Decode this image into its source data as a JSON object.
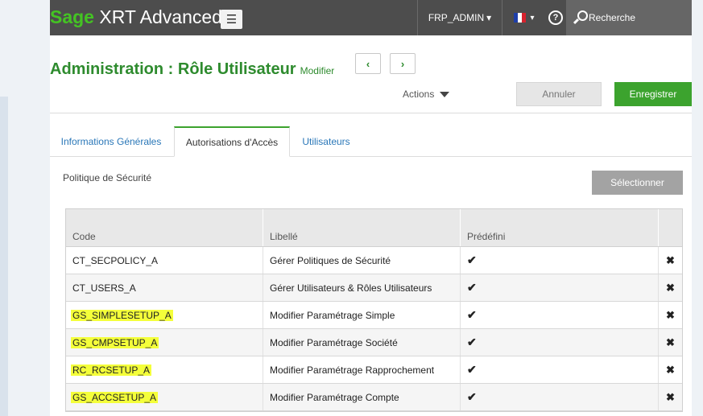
{
  "topbar": {
    "brand": "Sage",
    "product": "XRT Advanced",
    "menu_icon": "hamburger-icon",
    "user": "FRP_ADMIN",
    "language_flag_colors": [
      "#1f3fa8",
      "#ffffff",
      "#d6222d"
    ],
    "search_placeholder": "Recherche"
  },
  "header": {
    "title": "Administration : Rôle Utilisateur",
    "mode": "Modifier",
    "prev_symbol": "‹",
    "next_symbol": "›",
    "actions_label": "Actions",
    "cancel_label": "Annuler",
    "save_label": "Enregistrer"
  },
  "tabs": [
    {
      "label": "Informations Générales",
      "active": false
    },
    {
      "label": "Autorisations d'Accès",
      "active": true
    },
    {
      "label": "Utilisateurs",
      "active": false
    }
  ],
  "section": {
    "label": "Politique de Sécurité",
    "select_label": "Sélectionner"
  },
  "table": {
    "headers": [
      "Code",
      "Libellé",
      "Prédéfini"
    ],
    "rows": [
      {
        "code": "CT_SECPOLICY_A",
        "label": "Gérer Politiques de Sécurité",
        "predefined": "✔",
        "highlighted": false
      },
      {
        "code": "CT_USERS_A",
        "label": "Gérer Utilisateurs & Rôles Utilisateurs",
        "predefined": "✔",
        "highlighted": false
      },
      {
        "code": "GS_SIMPLESETUP_A",
        "label": "Modifier Paramétrage Simple",
        "predefined": "✔",
        "highlighted": true
      },
      {
        "code": "GS_CMPSETUP_A",
        "label": "Modifier Paramétrage Société",
        "predefined": "✔",
        "highlighted": true
      },
      {
        "code": "RC_RCSETUP_A",
        "label": "Modifier Paramétrage Rapprochement",
        "predefined": "✔",
        "highlighted": true
      },
      {
        "code": "GS_ACCSETUP_A",
        "label": "Modifier Paramétrage Compte",
        "predefined": "✔",
        "highlighted": true
      }
    ],
    "delete_symbol": "✖"
  },
  "colors": {
    "brand_green": "#44c323",
    "title_green": "#2e8b2e",
    "save_green": "#3ca32e",
    "highlight": "#f4ff3a",
    "topbar": "#4d4d4d"
  }
}
